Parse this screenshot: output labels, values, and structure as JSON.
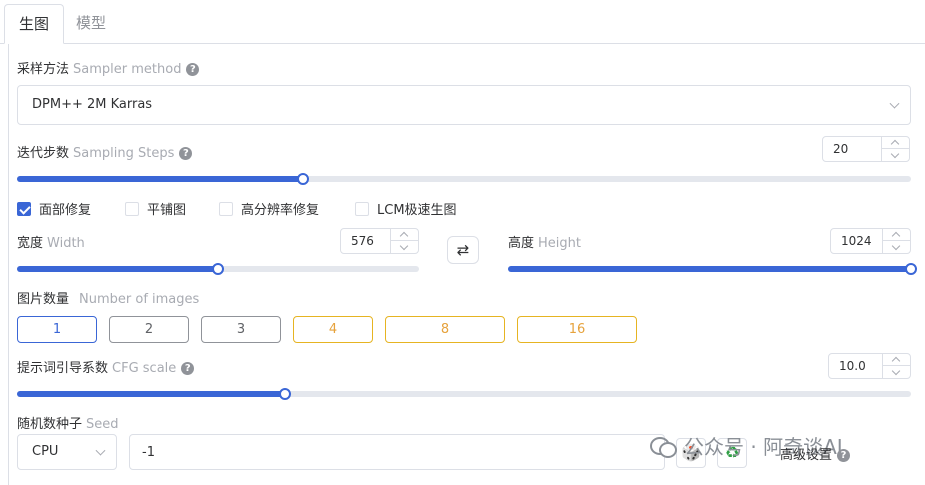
{
  "tabs": [
    {
      "label": "生图",
      "active": true
    },
    {
      "label": "模型",
      "active": false
    }
  ],
  "sampler": {
    "label": "采样方法",
    "label_en": "Sampler method",
    "value": "DPM++ 2M Karras"
  },
  "steps": {
    "label": "迭代步数",
    "label_en": "Sampling Steps",
    "value": "20",
    "slider_fraction": 0.32
  },
  "options": [
    {
      "label": "面部修复",
      "checked": true
    },
    {
      "label": "平铺图",
      "checked": false
    },
    {
      "label": "高分辨率修复",
      "checked": false
    },
    {
      "label": "LCM极速生图",
      "checked": false
    }
  ],
  "width": {
    "label": "宽度",
    "label_en": "Width",
    "value": "576",
    "slider_fraction": 0.5
  },
  "height": {
    "label": "高度",
    "label_en": "Height",
    "value": "1024",
    "slider_fraction": 1.0
  },
  "swap_icon": "swap-arrows-icon",
  "images": {
    "label": "图片数量",
    "label_en": "Number of images",
    "buttons": [
      "1",
      "2",
      "3",
      "4",
      "8",
      "16"
    ],
    "selected": "1"
  },
  "cfg": {
    "label": "提示词引导系数",
    "label_en": "CFG scale",
    "value": "10.0",
    "slider_fraction": 0.3
  },
  "seed": {
    "label": "随机数种子",
    "label_en": "Seed",
    "device": "CPU",
    "value": "-1"
  },
  "advanced": {
    "label": "高级设置"
  },
  "watermark": {
    "text": "公众号 · 阿奇谈AI"
  },
  "colors": {
    "primary": "#3a66d6",
    "warning": "#e6a23c",
    "border": "#dcdfe6"
  }
}
